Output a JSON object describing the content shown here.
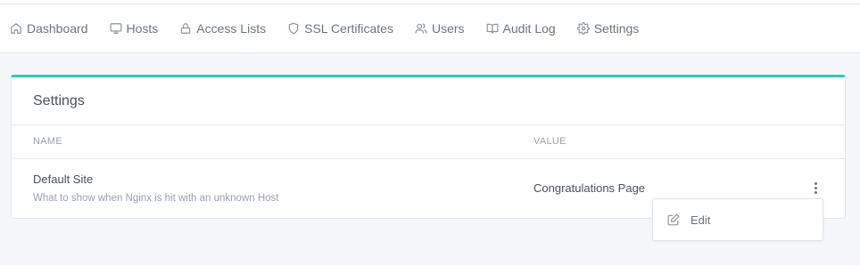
{
  "nav": {
    "items": [
      {
        "label": "Dashboard",
        "icon": "home-icon"
      },
      {
        "label": "Hosts",
        "icon": "monitor-icon"
      },
      {
        "label": "Access Lists",
        "icon": "lock-icon"
      },
      {
        "label": "SSL Certificates",
        "icon": "shield-icon"
      },
      {
        "label": "Users",
        "icon": "users-icon"
      },
      {
        "label": "Audit Log",
        "icon": "book-icon"
      },
      {
        "label": "Settings",
        "icon": "gear-icon"
      }
    ]
  },
  "card": {
    "title": "Settings",
    "accent_color": "#2bcbba",
    "columns": {
      "name": "NAME",
      "value": "VALUE"
    },
    "rows": [
      {
        "name": "Default Site",
        "description": "What to show when Nginx is hit with an unknown Host",
        "value": "Congratulations Page"
      }
    ]
  },
  "dropdown": {
    "items": [
      {
        "label": "Edit",
        "icon": "edit-icon"
      }
    ]
  }
}
